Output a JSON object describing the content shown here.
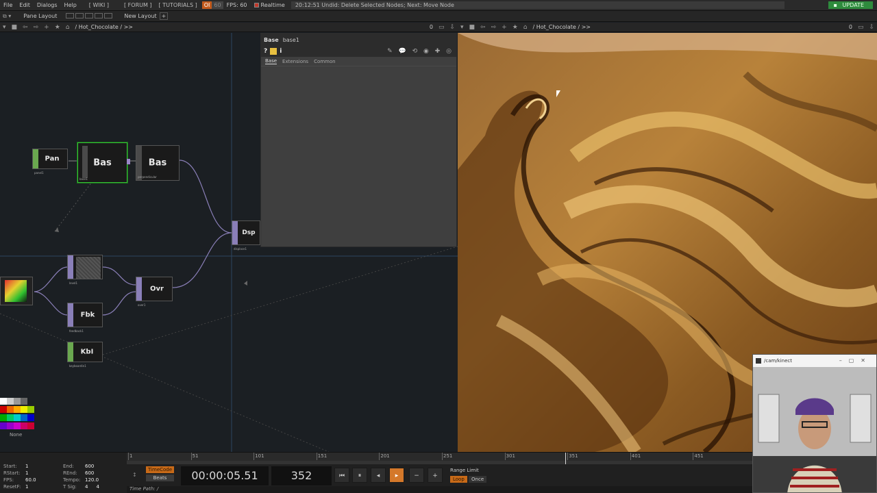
{
  "menu": {
    "items": [
      "File",
      "Edit",
      "Dialogs",
      "Help"
    ],
    "links": [
      "[ WIKI ]",
      "[ FORUM ]",
      "[ TUTORIALS ]"
    ],
    "oi_label": "OI",
    "oi2_label": "60",
    "fps_label": "FPS:  60",
    "realtime_label": "Realtime",
    "status_message": "20:12:51 Undid: Delete Selected Nodes; Next: Move Node",
    "update_label": "UPDATE"
  },
  "panebar": {
    "pane_layout_label": "Pane Layout",
    "new_layout_label": "New Layout",
    "plus": "+"
  },
  "network_path": {
    "path": "/ Hot_Chocolate / >>",
    "zoom_zero": "0"
  },
  "viewer_path": {
    "path": "/ Hot_Chocolate / >>",
    "zoom_zero": "0"
  },
  "nodes": {
    "pan": {
      "label": "Pan",
      "name": "panel1"
    },
    "bas1": {
      "label": "Bas",
      "name": "base1"
    },
    "bas2": {
      "label": "Bas",
      "name": "perpendicular"
    },
    "dsp": {
      "label": "Dsp",
      "name": "displace1"
    },
    "level": {
      "label": "",
      "name": "level1"
    },
    "ovr": {
      "label": "Ovr",
      "name": "over1"
    },
    "fbk": {
      "label": "Fbk",
      "name": "feedback1"
    },
    "kbi": {
      "label": "KbI",
      "name": "keyboardin1"
    }
  },
  "params": {
    "type": "Base",
    "name": "base1",
    "help": "?",
    "info": "i",
    "tabs": [
      "Base",
      "Extensions",
      "Common"
    ]
  },
  "timeline": {
    "ruler_ticks": [
      "1",
      "51",
      "101",
      "151",
      "201",
      "251",
      "301",
      "351",
      "401",
      "451"
    ],
    "stats": {
      "start_k": "Start:",
      "start_v": "1",
      "end_k": "End:",
      "end_v": "600",
      "rstart_k": "RStart:",
      "rstart_v": "1",
      "rend_k": "REnd:",
      "rend_v": "600",
      "fps_k": "FPS:",
      "fps_v": "60.0",
      "tempo_k": "Tempo:",
      "tempo_v": "120.0",
      "resetf_k": "ResetF:",
      "resetf_v": "1",
      "tsig_k": "T Sig:",
      "tsig_v1": "4",
      "tsig_v2": "4"
    },
    "timecode_label": "TimeCode",
    "beats_label": "Beats",
    "timecode": "00:00:05.51",
    "frame": "352",
    "range_limit_label": "Range Limit",
    "loop_label": "Loop",
    "once_label": "Once",
    "time_path": "Time Path: /"
  },
  "palette": {
    "none_label": "None"
  },
  "webcam": {
    "title": "/cam/kinect"
  },
  "colors": {
    "selection": "#36c236",
    "play": "#d4782a",
    "update": "#2e8b3d",
    "chocolate_dark": "#3b1f0a",
    "chocolate_light": "#e8b866"
  }
}
